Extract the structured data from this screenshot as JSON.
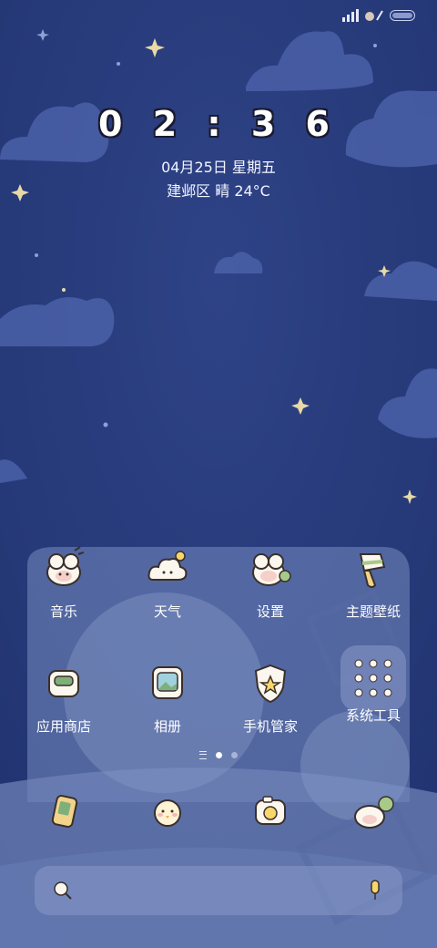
{
  "colors": {
    "background": "#26397a",
    "text": "#ffffff"
  },
  "clock": {
    "time": "0 2 : 3 6"
  },
  "date": {
    "text": "04月25日 星期五"
  },
  "weather": {
    "text": "建邺区 晴 24°C"
  },
  "apps": [
    {
      "label": "音乐",
      "icon": "sheep-music-icon"
    },
    {
      "label": "天气",
      "icon": "cloud-weather-icon"
    },
    {
      "label": "设置",
      "icon": "sheep-settings-icon"
    },
    {
      "label": "主题壁纸",
      "icon": "paint-brush-icon"
    },
    {
      "label": "应用商店",
      "icon": "shopping-bag-icon"
    },
    {
      "label": "相册",
      "icon": "photo-frame-icon"
    },
    {
      "label": "手机管家",
      "icon": "shield-star-icon"
    },
    {
      "label": "系统工具",
      "icon": "folder-grid-icon"
    }
  ],
  "dock": [
    {
      "icon": "phone-icon"
    },
    {
      "icon": "chick-messages-icon"
    },
    {
      "icon": "camera-icon"
    },
    {
      "icon": "sheep-chat-icon"
    }
  ],
  "search": {
    "left_icon": "search-icon",
    "right_icon": "mic-icon"
  }
}
